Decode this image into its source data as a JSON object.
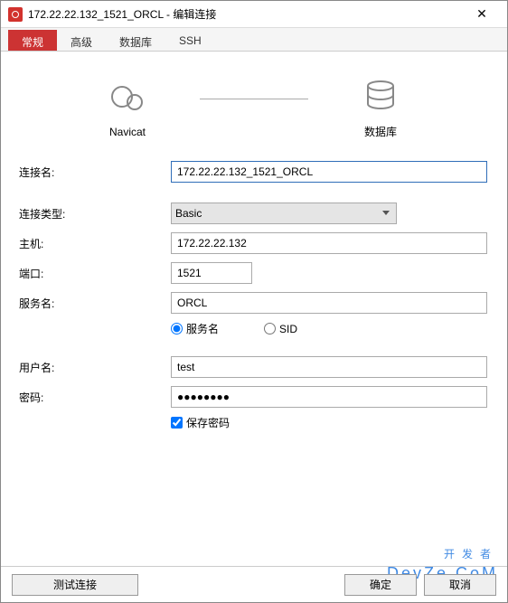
{
  "window": {
    "title": "172.22.22.132_1521_ORCL - 编辑连接"
  },
  "tabs": {
    "general": "常规",
    "advanced": "高级",
    "database": "数据库",
    "ssh": "SSH"
  },
  "diagram": {
    "left_label": "Navicat",
    "right_label": "数据库"
  },
  "labels": {
    "conn_name": "连接名:",
    "conn_type": "连接类型:",
    "host": "主机:",
    "port": "端口:",
    "service_name": "服务名:",
    "username": "用户名:",
    "password": "密码:"
  },
  "values": {
    "conn_name": "172.22.22.132_1521_ORCL",
    "conn_type": "Basic",
    "host": "172.22.22.132",
    "port": "1521",
    "service_name": "ORCL",
    "username": "test",
    "password": "●●●●●●●●"
  },
  "radios": {
    "service_name": "服务名",
    "sid": "SID"
  },
  "check": {
    "save_password": "保存密码"
  },
  "footer": {
    "test": "测试连接",
    "ok": "确定",
    "cancel": "取消"
  },
  "watermark": {
    "line1": "开发者",
    "line2": "DevZe.CoM"
  }
}
